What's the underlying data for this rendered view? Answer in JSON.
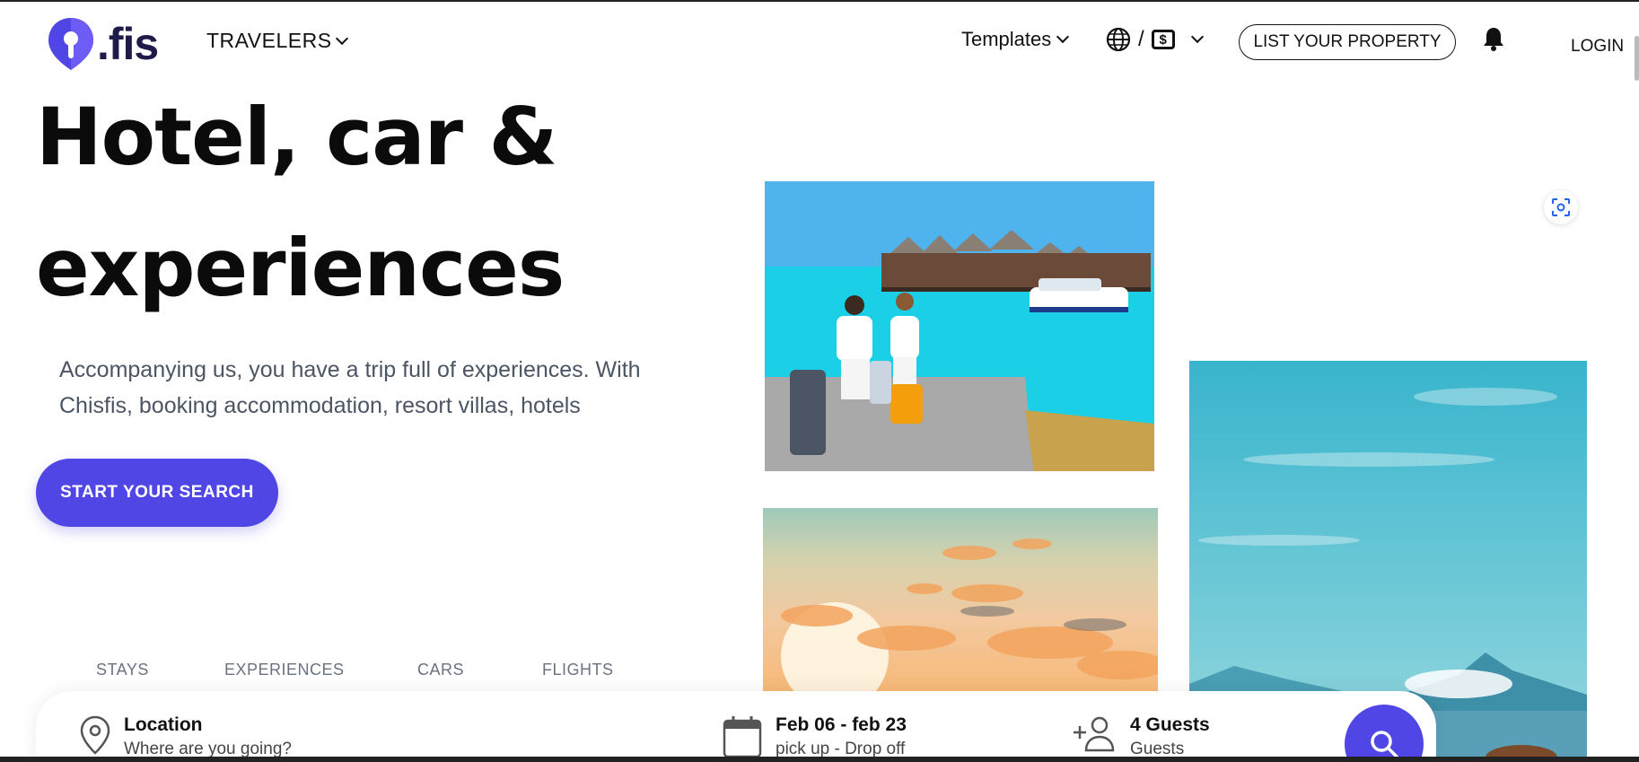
{
  "brand": {
    "logo_text": ".fis",
    "accent": "#4f46e5"
  },
  "header": {
    "travelers_label": "TRAVELERS",
    "templates_label": "Templates",
    "lang_separator": "/",
    "currency_symbol": "$",
    "list_property_label": "LIST YOUR PROPERTY",
    "login_label": "LOGIN"
  },
  "hero": {
    "title_line1": "Hotel, car &",
    "title_line2": "experiences",
    "description": "Accompanying us, you have a trip full of experiences. With Chisfis, booking accommodation, resort villas, hotels",
    "cta_label": "START YOUR SEARCH"
  },
  "tabs": [
    {
      "label": "STAYS"
    },
    {
      "label": "EXPERIENCES"
    },
    {
      "label": "CARS"
    },
    {
      "label": "FLIGHTS"
    }
  ],
  "search": {
    "location": {
      "title": "Location",
      "subtitle": "Where are you going?"
    },
    "dates": {
      "title": "Feb 06 - feb 23",
      "subtitle": "pick up - Drop off"
    },
    "guests": {
      "title": "4 Guests",
      "subtitle": "Guests"
    }
  },
  "icons": [
    "logo-pin-icon",
    "chevron-down-icon",
    "globe-icon",
    "currency-icon",
    "bell-icon",
    "scan-icon",
    "location-pin-icon",
    "calendar-icon",
    "add-user-icon",
    "search-icon"
  ]
}
